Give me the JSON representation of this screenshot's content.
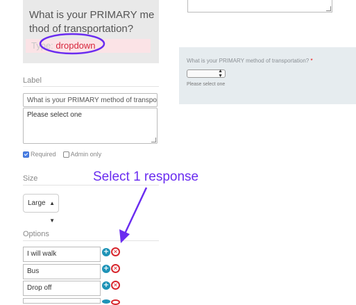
{
  "question_card": {
    "title": "What is your PRIMARY method of transportation?",
    "type_label": "Type:",
    "type_value": "dropdown"
  },
  "editor": {
    "label_heading": "Label",
    "label_value": "What is your PRIMARY method of transportation?",
    "help_text": "Please select one",
    "required_label": "Required",
    "required_checked": true,
    "admin_only_label": "Admin only",
    "admin_only_checked": false,
    "size_heading": "Size",
    "size_value": "Large",
    "options_heading": "Options",
    "options": [
      "I will walk",
      "Bus",
      "Drop off"
    ]
  },
  "annotation": {
    "text": "Select 1 response",
    "color": "#6a2cf0"
  },
  "preview": {
    "question": "What is your PRIMARY method of transportation?",
    "required_marker": "*",
    "help_text": "Please select one"
  },
  "colors": {
    "accent_red": "#d7263d",
    "add_icon": "#1e93b7",
    "annotation_purple": "#6a2cf0"
  }
}
